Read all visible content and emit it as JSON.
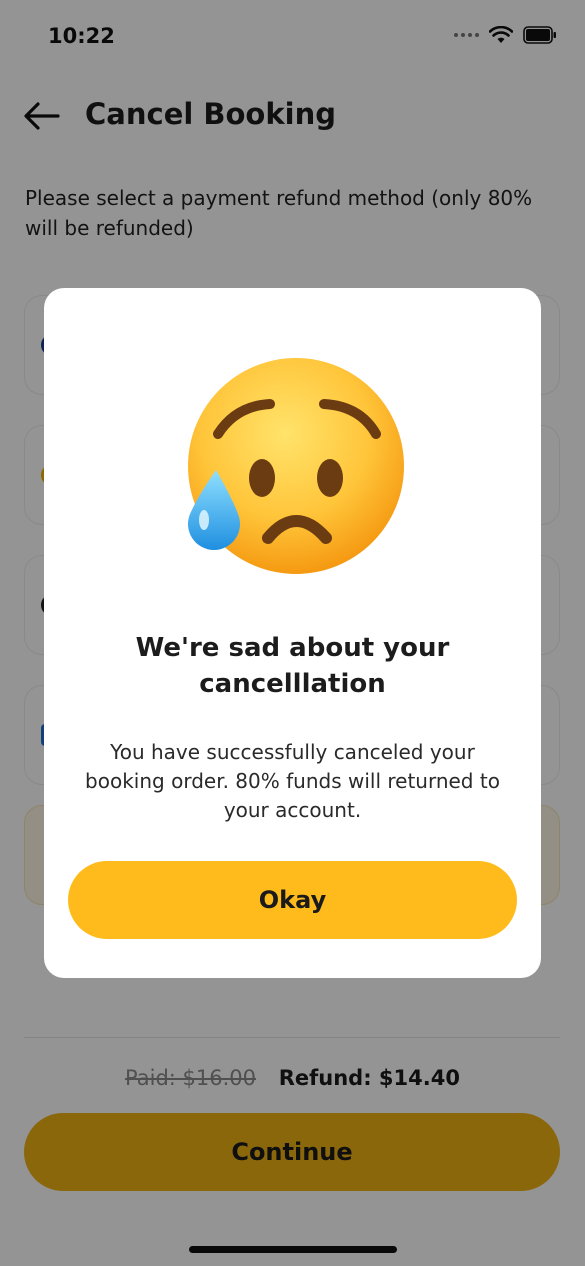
{
  "status_bar": {
    "time": "10:22"
  },
  "header": {
    "title": "Cancel Booking"
  },
  "instructions": "Please select a payment refund method (only 80% will be refunded)",
  "summary": {
    "paid": "Paid: $16.00",
    "refund": "Refund: $14.40"
  },
  "continue_label": "Continue",
  "modal": {
    "title": "We're sad about your cancelllation",
    "message": "You have successfully canceled your booking order. 80% funds will returned to your account.",
    "okay_label": "Okay"
  },
  "colors": {
    "accent": "#FFBB1C",
    "overlay": "rgba(0,0,0,0.42)"
  },
  "icons": {
    "back": "arrow-left-icon",
    "emoji": "sad-but-relieved-face-icon"
  }
}
